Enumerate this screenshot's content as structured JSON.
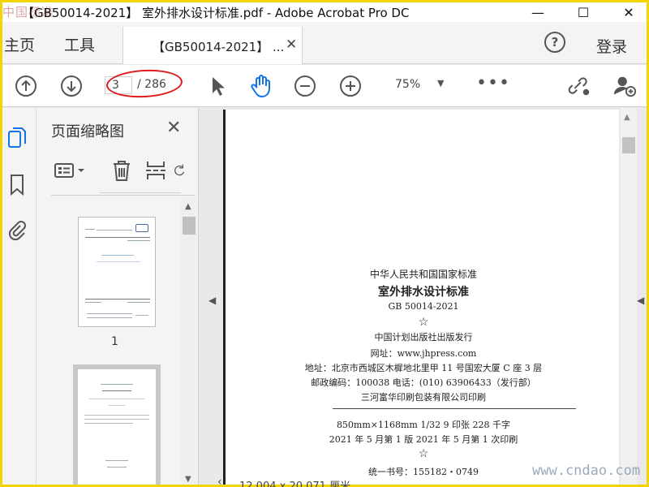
{
  "window": {
    "watermark_logo": "中国标准",
    "title": "【GB50014-2021】 室外排水设计标准.pdf - Adobe Acrobat Pro DC",
    "minimize": "—",
    "maximize": "☐",
    "close": "✕"
  },
  "tabs": {
    "home": "主页",
    "tools": "工具",
    "doc_tab_label": "【GB50014-2021】 ...",
    "doc_tab_close": "✕",
    "help": "?",
    "login": "登录"
  },
  "toolbar": {
    "current_page": "3",
    "total_pages": "/ 286",
    "zoom": "75%",
    "zoom_caret": "▼",
    "more": "•••",
    "annotation_color": "#e01a1a",
    "accent_color": "#1473e6"
  },
  "panel": {
    "title": "页面缩略图",
    "close": "✕",
    "thumbnail_1_label": "1"
  },
  "page": {
    "line1": "中华人民共和国国家标准",
    "line2": "室外排水设计标准",
    "line3": "GB 50014-2021",
    "star": "☆",
    "line4": "中国计划出版社出版发行",
    "line5": "网址：www.jhpress.com",
    "line6": "地址：北京市西城区木樨地北里甲 11 号国宏大厦 C 座 3 层",
    "line7": "邮政编码：100038   电话：(010) 63906433（发行部）",
    "line8": "三河富华印刷包装有限公司印刷",
    "line9": "850mm×1168mm   1/32   9 印张   228 千字",
    "line10": "2021 年 5 月第 1 版   2021 年 5 月第 1 次印刷",
    "star2": "☆",
    "line11": "统一书号：155182・0749"
  },
  "status": {
    "left_arrow": "‹",
    "dimensions": "12.004 x 20.071 厘米"
  },
  "watermark_bottom": "www.cndao.com"
}
